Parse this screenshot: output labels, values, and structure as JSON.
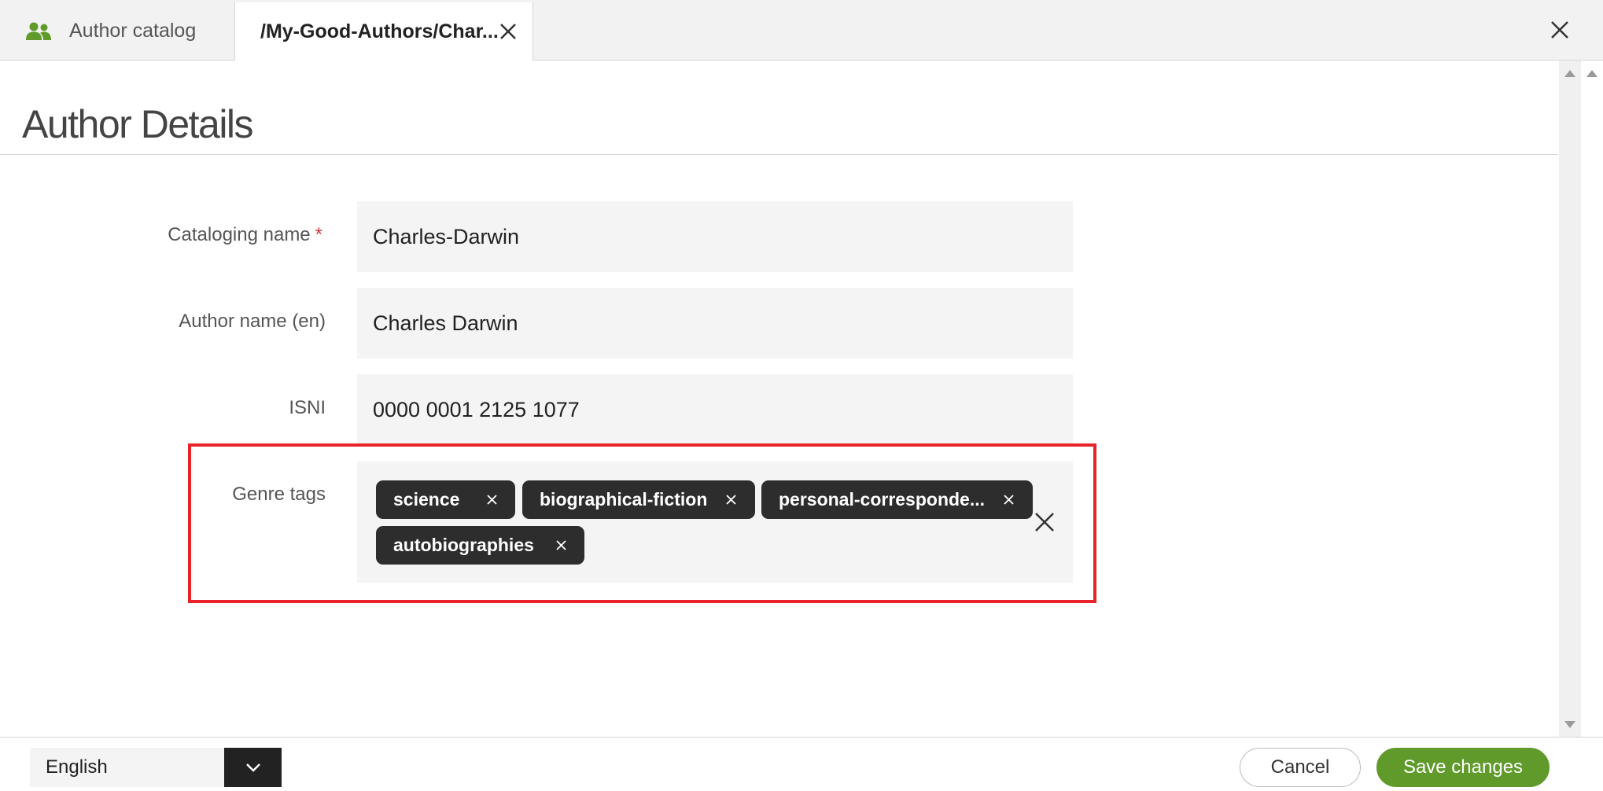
{
  "tabs": [
    {
      "label": "Author catalog",
      "icon": "people-icon",
      "active": false
    },
    {
      "label": "/My-Good-Authors/Char...",
      "active": true
    }
  ],
  "header": {
    "title": "Author Details"
  },
  "form": {
    "cataloging_name": {
      "label": "Cataloging name",
      "required_mark": "*",
      "value": "Charles-Darwin"
    },
    "author_name": {
      "label": "Author name (en)",
      "value": "Charles Darwin"
    },
    "isni": {
      "label": "ISNI",
      "value": "0000 0001 2125 1077"
    },
    "genre_tags": {
      "label": "Genre tags",
      "tags": [
        "science",
        "biographical-fiction",
        "personal-corresponde...",
        "autobiographies"
      ]
    }
  },
  "footer": {
    "language": "English",
    "cancel_label": "Cancel",
    "save_label": "Save changes"
  },
  "colors": {
    "accent_green": "#5f9a2b",
    "tag_bg": "#2d2d2d",
    "highlight": "#e8242a",
    "required": "#d9363e"
  }
}
